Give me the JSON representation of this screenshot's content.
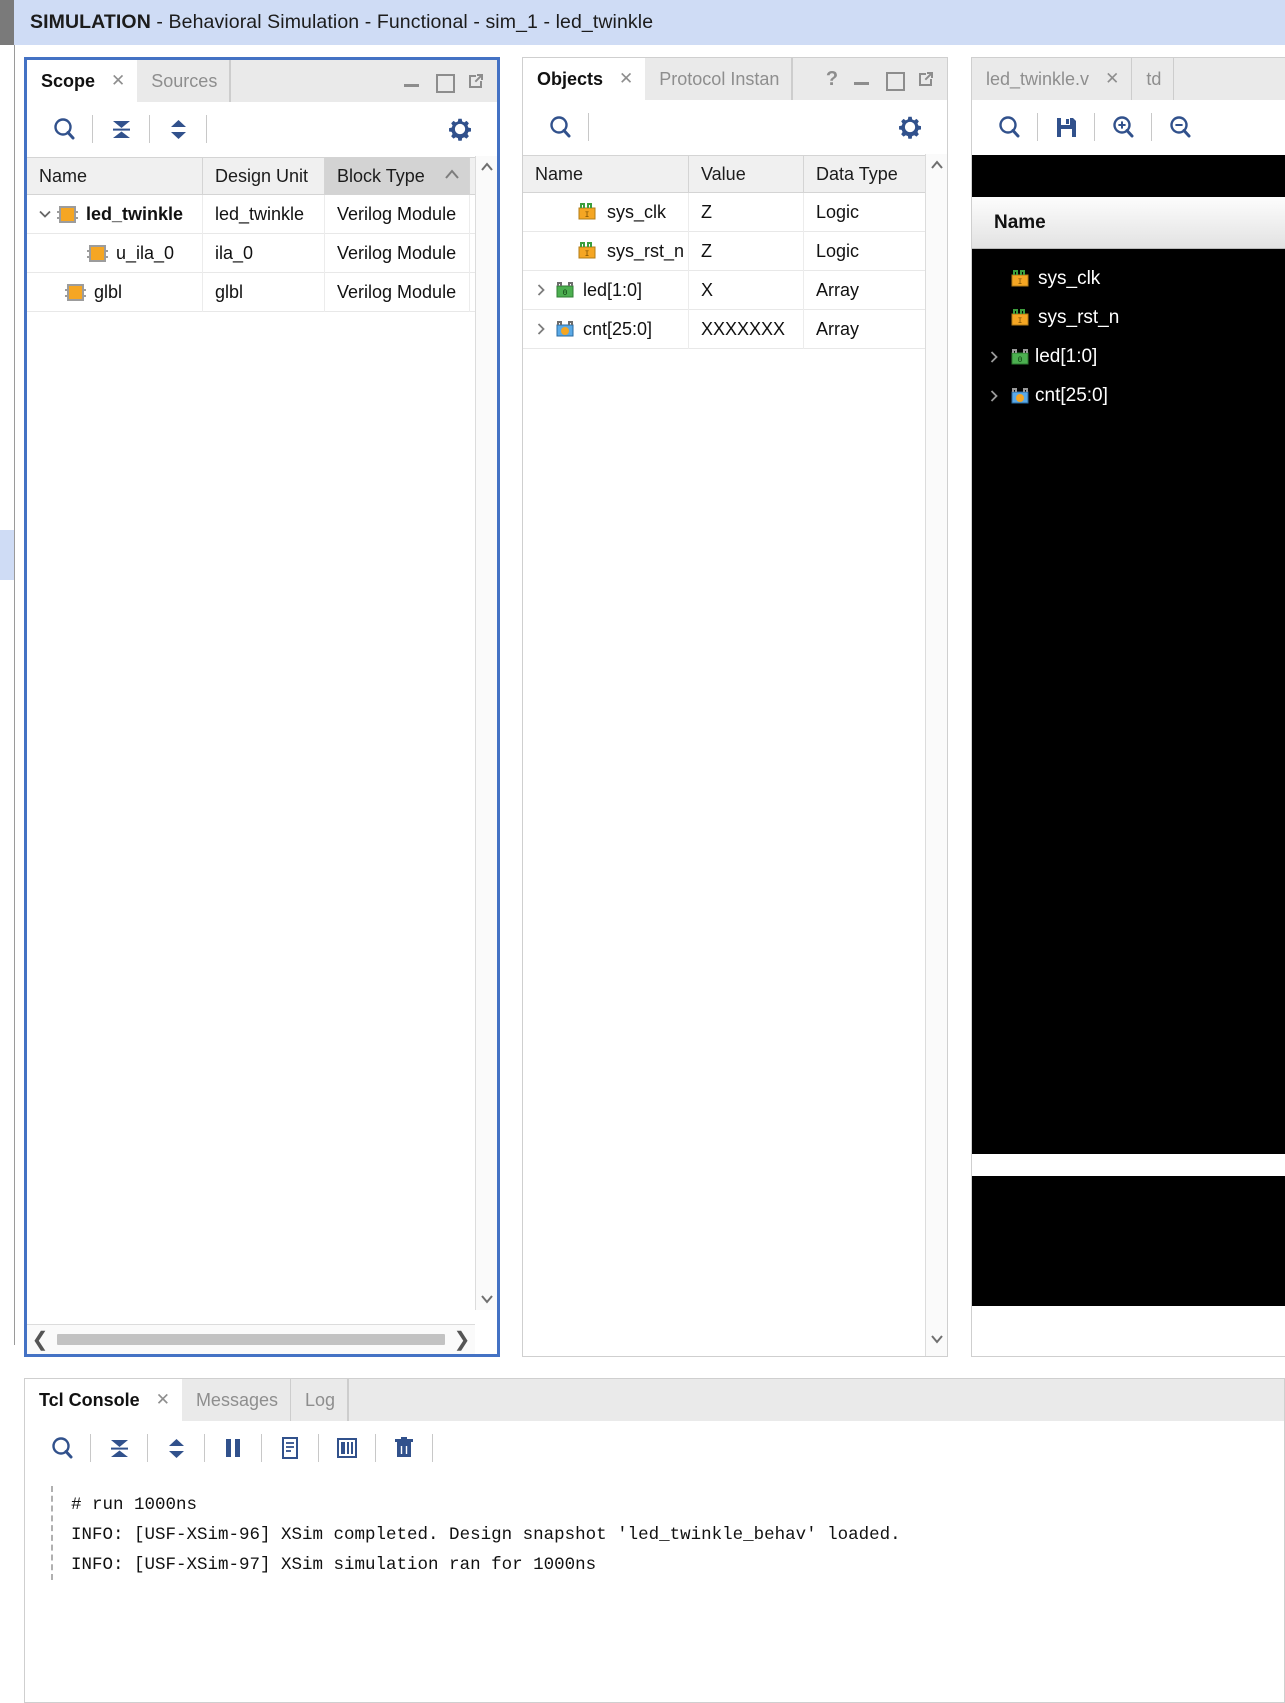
{
  "banner": {
    "app_mode": "SIMULATION",
    "title_rest": " - Behavioral Simulation - Functional - sim_1 - led_twinkle",
    "full_title": "SIMULATION - Behavioral Simulation - Functional - sim_1 - led_twinkle",
    "bg_color": "#cfdcf5"
  },
  "scope": {
    "tabs": [
      {
        "label": "Scope",
        "active": true,
        "closable": true
      },
      {
        "label": "Sources",
        "active": false,
        "closable": false
      }
    ],
    "window_controls": [
      "minimize",
      "maximize",
      "float"
    ],
    "toolbar": [
      {
        "name": "search-icon",
        "label": "Search"
      },
      {
        "name": "collapse-all-icon",
        "label": "Collapse All"
      },
      {
        "name": "expand-all-icon",
        "label": "Expand All"
      },
      {
        "name": "settings-gear-icon",
        "label": "Settings"
      }
    ],
    "columns": [
      "Name",
      "Design Unit",
      "Block Type"
    ],
    "sorted_column": "Block Type",
    "sort_direction": "asc",
    "rows": [
      {
        "name": "led_twinkle",
        "design_unit": "led_twinkle",
        "block_type": "Verilog Module",
        "indent": 0,
        "expanded": true,
        "bold": true,
        "icon": "verilog-module-icon"
      },
      {
        "name": "u_ila_0",
        "design_unit": "ila_0",
        "block_type": "Verilog Module",
        "indent": 1,
        "expanded": null,
        "bold": false,
        "icon": "verilog-module-icon"
      },
      {
        "name": "glbl",
        "design_unit": "glbl",
        "block_type": "Verilog Module",
        "indent": 0,
        "expanded": null,
        "bold": false,
        "icon": "verilog-module-icon"
      }
    ]
  },
  "objects": {
    "tabs": [
      {
        "label": "Objects",
        "active": true,
        "closable": true
      },
      {
        "label": "Protocol Instan",
        "active": false,
        "closable": false
      }
    ],
    "window_controls": [
      "help",
      "minimize",
      "maximize",
      "float"
    ],
    "toolbar": [
      {
        "name": "search-icon",
        "label": "Search"
      },
      {
        "name": "settings-gear-icon",
        "label": "Settings"
      }
    ],
    "columns": [
      "Name",
      "Value",
      "Data Type"
    ],
    "rows": [
      {
        "name": "sys_clk",
        "value": "Z",
        "data_type": "Logic",
        "expandable": false,
        "icon": "logic-signal-icon"
      },
      {
        "name": "sys_rst_n",
        "value": "Z",
        "data_type": "Logic",
        "expandable": false,
        "icon": "logic-signal-icon"
      },
      {
        "name": "led[1:0]",
        "value": "X",
        "data_type": "Array",
        "expandable": true,
        "icon": "array-signal-icon"
      },
      {
        "name": "cnt[25:0]",
        "value": "XXXXXXX",
        "data_type": "Array",
        "expandable": true,
        "icon": "array-signal-icon"
      }
    ]
  },
  "wave": {
    "tabs": [
      {
        "label": "led_twinkle.v",
        "active": false,
        "closable": true
      },
      {
        "label": "td",
        "active": false,
        "closable": false
      }
    ],
    "toolbar": [
      {
        "name": "search-icon",
        "label": "Search"
      },
      {
        "name": "save-icon",
        "label": "Save"
      },
      {
        "name": "zoom-in-icon",
        "label": "Zoom In"
      },
      {
        "name": "zoom-out-icon",
        "label": "Zoom Out"
      }
    ],
    "name_header": "Name",
    "signals": [
      {
        "name": "sys_clk",
        "expandable": false,
        "icon": "logic-signal-icon"
      },
      {
        "name": "sys_rst_n",
        "expandable": false,
        "icon": "logic-signal-icon"
      },
      {
        "name": "led[1:0]",
        "expandable": true,
        "icon": "array-signal-icon"
      },
      {
        "name": "cnt[25:0]",
        "expandable": true,
        "icon": "array-signal-icon"
      }
    ]
  },
  "tcl": {
    "tabs": [
      {
        "label": "Tcl Console",
        "active": true,
        "closable": true
      },
      {
        "label": "Messages",
        "active": false,
        "closable": false
      },
      {
        "label": "Log",
        "active": false,
        "closable": false
      }
    ],
    "toolbar": [
      {
        "name": "search-icon",
        "label": "Search"
      },
      {
        "name": "collapse-all-icon",
        "label": "Collapse All"
      },
      {
        "name": "expand-all-icon",
        "label": "Expand All"
      },
      {
        "name": "pause-icon",
        "label": "Pause"
      },
      {
        "name": "copy-icon",
        "label": "Copy"
      },
      {
        "name": "save-log-icon",
        "label": "Save Log"
      },
      {
        "name": "clear-icon",
        "label": "Clear"
      }
    ],
    "lines": [
      "# run 1000ns",
      "INFO: [USF-XSim-96] XSim completed. Design snapshot 'led_twinkle_behav' loaded.",
      "INFO: [USF-XSim-97] XSim simulation ran for 1000ns"
    ]
  },
  "colors": {
    "accent_blue": "#4472c4",
    "banner_bg": "#cfdcf5",
    "icon_blue": "#31518c",
    "module_orange": "#f5a623",
    "wave_bg": "#000000"
  }
}
